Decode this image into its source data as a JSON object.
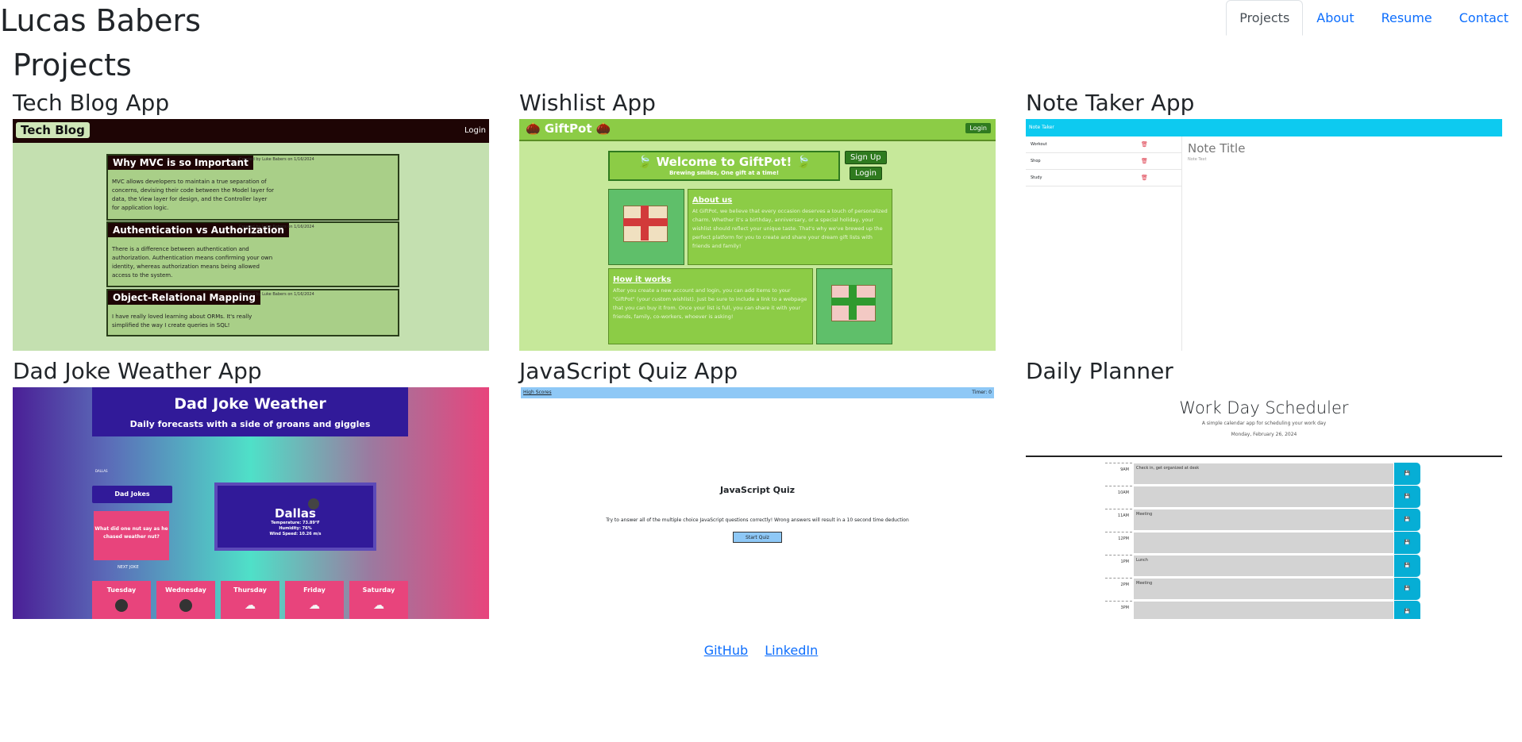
{
  "header": {
    "site_title": "Lucas Babers",
    "nav": [
      "Projects",
      "About",
      "Resume",
      "Contact"
    ],
    "active_tab": "Projects"
  },
  "page_title": "Projects",
  "projects": [
    {
      "title": "Tech Blog App",
      "preview": {
        "brand": "Tech Blog",
        "login": "Login",
        "posts": [
          {
            "title": "Why MVC is so Important",
            "meta": "Created by Luke Babers on 1/16/2024",
            "body": "MVC allows developers to maintain a true separation of concerns, devising their code between the Model layer for data, the View layer for design, and the Controller layer for application logic."
          },
          {
            "title": "Authentication vs Authorization",
            "meta": "Created by Luke Babers on 1/16/2024",
            "body": "There is a difference between authentication and authorization. Authentication means confirming your own identity, whereas authorization means being allowed access to the system."
          },
          {
            "title": "Object-Relational Mapping",
            "meta": "Created by Luke Babers on 1/16/2024",
            "body": "I have really loved learning about ORMs. It's really simplified the way I create queries in SQL!"
          }
        ]
      }
    },
    {
      "title": "Wishlist App",
      "preview": {
        "brand": "🌰 GiftPot 🌰",
        "login": "Login",
        "welcome": "🍃 Welcome to GiftPot! 🍃",
        "tagline": "Brewing smiles, One gift at a time!",
        "signup": "Sign Up",
        "login2": "Login",
        "about_title": "About us",
        "about_body": "At GiftPot, we believe that every occasion deserves a touch of personalized charm. Whether it's a birthday, anniversary, or a special holiday, your wishlist should reflect your unique taste. That's why we've brewed up the perfect platform for you to create and share your dream gift lists with friends and family!",
        "how_title": "How it works",
        "how_body": "After you create a new account and login, you can add items to your \"GiftPot\" (your custom wishlist). Just be sure to include a link to a webpage that you can buy it from. Once your list is full, you can share it with your friends, family, co-workers, whoever is asking!"
      }
    },
    {
      "title": "Note Taker App",
      "preview": {
        "brand": "Note Taker",
        "notes": [
          "Workout",
          "Shop",
          "Study"
        ],
        "note_title": "Note Title",
        "note_text": "Note Text"
      }
    },
    {
      "title": "Dad Joke Weather App",
      "preview": {
        "heading": "Dad Joke Weather",
        "subheading": "Daily forecasts with a side of groans and giggles",
        "history_label": "DALLAS",
        "jokes_button": "Dad Jokes",
        "joke": "What did one nut say as he chased weather nut?",
        "next_label": "NEXT JOKE",
        "city": "Dallas",
        "temp": "Temperature: 73.89°F",
        "humidity": "Humidity: 76%",
        "wind": "Wind Speed: 10.26 m/s",
        "days": [
          {
            "name": "Tuesday",
            "icon": "moon-icon"
          },
          {
            "name": "Wednesday",
            "icon": "moon-icon"
          },
          {
            "name": "Thursday",
            "icon": "cloud-icon"
          },
          {
            "name": "Friday",
            "icon": "cloud-icon"
          },
          {
            "name": "Saturday",
            "icon": "cloud-icon"
          }
        ]
      }
    },
    {
      "title": "JavaScript Quiz App",
      "preview": {
        "high_scores": "High Scores",
        "timer": "Timer: 0",
        "heading": "JavaScript Quiz",
        "description": "Try to answer all of the multiple choice JavaScript questions correctly! Wrong answers will result in a 10 second time deduction",
        "start": "Start Quiz"
      }
    },
    {
      "title": "Daily Planner",
      "preview": {
        "heading": "Work Day Scheduler",
        "subtitle": "A simple calendar app for scheduling your work day",
        "date": "Monday, February 26, 2024",
        "rows": [
          {
            "hour": "9AM",
            "text": "Check in, get organized at desk"
          },
          {
            "hour": "10AM",
            "text": ""
          },
          {
            "hour": "11AM",
            "text": "Meeting"
          },
          {
            "hour": "12PM",
            "text": ""
          },
          {
            "hour": "1PM",
            "text": "Lunch"
          },
          {
            "hour": "2PM",
            "text": "Meeting"
          },
          {
            "hour": "3PM",
            "text": ""
          }
        ]
      }
    }
  ],
  "footer": {
    "links": [
      "GitHub",
      "LinkedIn"
    ]
  }
}
